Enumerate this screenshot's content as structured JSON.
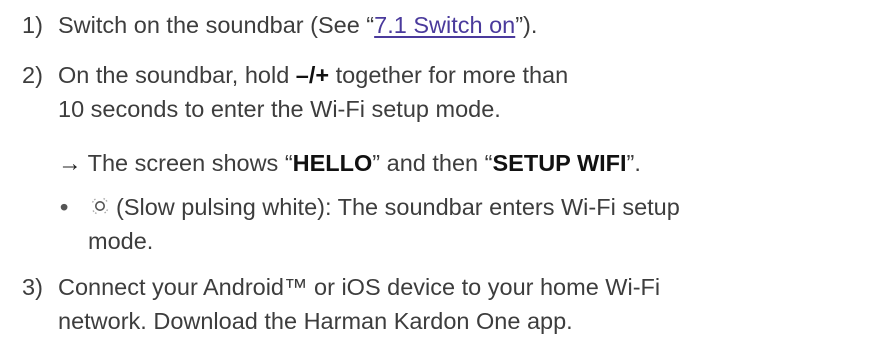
{
  "steps": [
    {
      "num": "1)",
      "pre": "Switch on the soundbar (See “",
      "link": "7.1 Switch on",
      "post": "”)."
    },
    {
      "num": "2)",
      "line1_pre": "On the soundbar, hold ",
      "keys": "–/+",
      "line1_post": " together for more than",
      "line2": "10 seconds to enter the Wi-Fi setup mode.",
      "result": {
        "arrow": "→",
        "pre": " The screen shows “",
        "bold1": "HELLO",
        "mid": "” and then “",
        "bold2": "SETUP WIFI",
        "post": "”."
      },
      "bullet": {
        "dot": "•",
        "icon": "slow-pulsing-led-icon",
        "line1": "(Slow pulsing white): The soundbar enters Wi-Fi setup",
        "line2": "mode."
      }
    },
    {
      "num": "3)",
      "line1": "Connect your Android™ or iOS device to your home Wi-Fi",
      "line2": "network. Download the Harman Kardon One app."
    }
  ],
  "colors": {
    "text": "#3d3d3d",
    "link": "#4a3a9c",
    "bold": "#111111"
  }
}
